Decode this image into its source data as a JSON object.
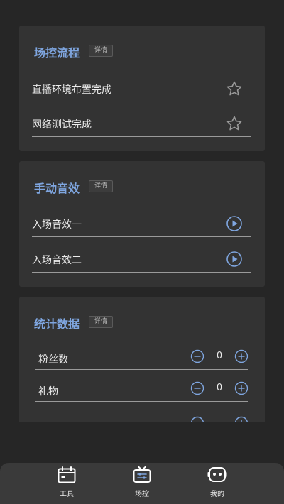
{
  "cards": {
    "flow": {
      "title": "场控流程",
      "badge": "详情",
      "items": [
        {
          "label": "直播环境布置完成",
          "icon": "star-outline-icon"
        },
        {
          "label": "网络测试完成",
          "icon": "star-outline-icon"
        }
      ]
    },
    "sound": {
      "title": "手动音效",
      "badge": "详情",
      "items": [
        {
          "label": "入场音效一",
          "icon": "play-circle-icon"
        },
        {
          "label": "入场音效二",
          "icon": "play-circle-icon"
        }
      ]
    },
    "stats": {
      "title": "统计数据",
      "badge": "详情",
      "items": [
        {
          "label": "粉丝数",
          "value": "0"
        },
        {
          "label": "礼物",
          "value": "0"
        }
      ]
    }
  },
  "tabs": [
    {
      "label": "工具",
      "icon": "toolbox-icon"
    },
    {
      "label": "场控",
      "icon": "tv-control-icon"
    },
    {
      "label": "我的",
      "icon": "robot-face-icon"
    }
  ],
  "colors": {
    "accent": "#7fa6e0",
    "background": "#262626",
    "card": "#333333",
    "tabbar": "#3a3a3a"
  }
}
